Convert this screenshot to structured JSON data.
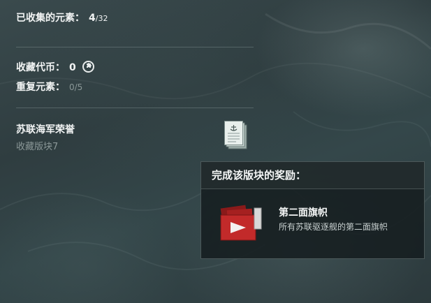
{
  "collected": {
    "label": "已收集的元素：",
    "count": "4",
    "total": "/32"
  },
  "coins": {
    "label": "收藏代币：",
    "value": "0",
    "icon": "puzzle-coin-icon"
  },
  "duplicates": {
    "label": "重复元素：",
    "value": "0/5"
  },
  "collection": {
    "title": "苏联海军荣誉",
    "subtitle": "收藏版块7",
    "icon": "document-icon"
  },
  "reward": {
    "header": "完成该版块的奖励：",
    "name": "第二面旗帜",
    "description": "所有苏联驱逐舰的第二面旗帜",
    "icon": "flag-icon"
  }
}
